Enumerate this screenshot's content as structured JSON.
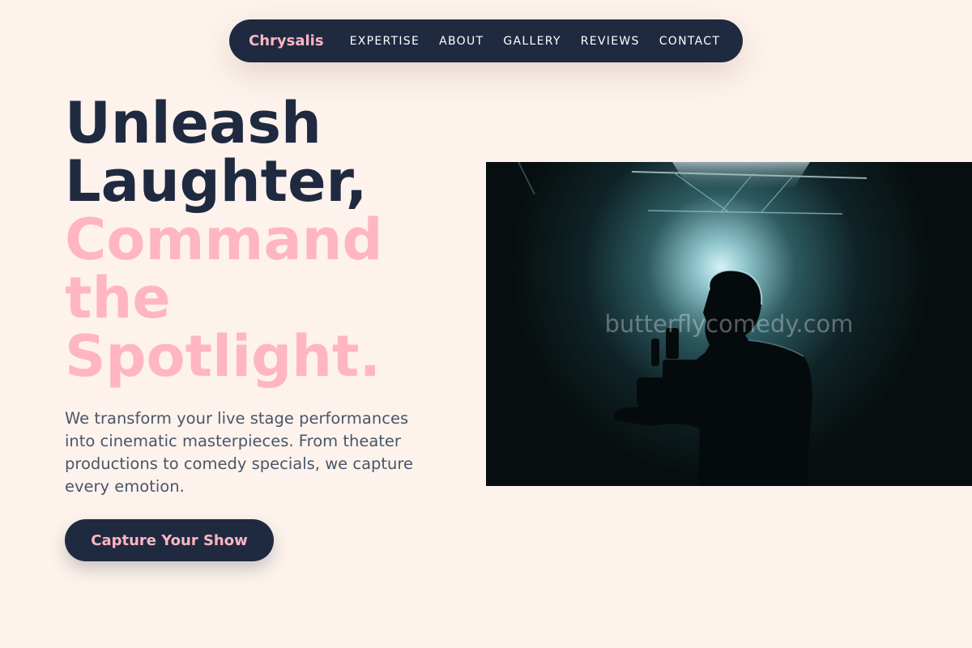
{
  "nav": {
    "brand": "Chrysalis",
    "links": [
      {
        "label": "EXPERTISE"
      },
      {
        "label": "ABOUT"
      },
      {
        "label": "GALLERY"
      },
      {
        "label": "REVIEWS"
      },
      {
        "label": "CONTACT"
      }
    ]
  },
  "hero": {
    "title_lines_dark": [
      "Unleash",
      "Laughter,"
    ],
    "title_lines_pink": [
      "Command",
      "the",
      "Spotlight."
    ],
    "description": "We transform your live stage performances into cinematic masterpieces. From theater productions to comedy specials, we capture every emotion.",
    "cta_label": "Capture Your Show"
  },
  "photo": {
    "watermark": "butterflycomedy.com"
  },
  "colors": {
    "background": "#fdf3ec",
    "navy": "#1f2a40",
    "pink": "#ffb6c1",
    "body_text": "#4a5568"
  }
}
